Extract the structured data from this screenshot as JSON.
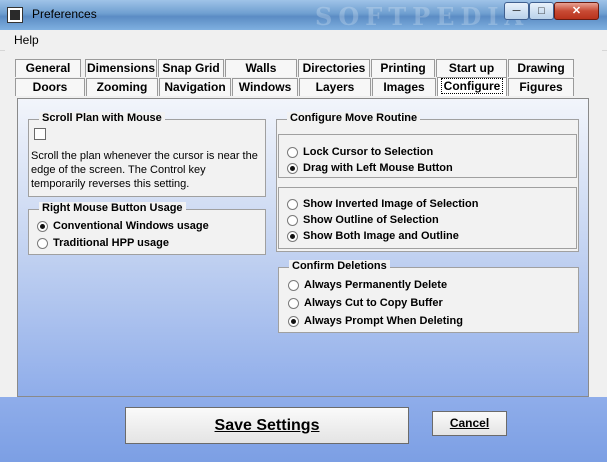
{
  "window": {
    "title": "Preferences",
    "watermark": "SOFTPEDIA"
  },
  "menu": {
    "help": "Help"
  },
  "tabs_row1": [
    "General",
    "Dimensions",
    "Snap Grid",
    "Walls",
    "Directories",
    "Printing",
    "Start up",
    "Drawing"
  ],
  "tabs_row2": [
    "Doors",
    "Zooming",
    "Navigation",
    "Windows",
    "Layers",
    "Images",
    "Configure",
    "Figures"
  ],
  "active_tab": "Configure",
  "scroll_plan": {
    "title": "Scroll Plan with Mouse",
    "checked": false,
    "description": "Scroll the plan whenever the cursor is near the edge of the screen. The Control key temporarily reverses this setting."
  },
  "right_mouse": {
    "title": "Right Mouse Button Usage",
    "options": [
      {
        "label": "Conventional Windows usage",
        "selected": true
      },
      {
        "label": "Traditional HPP usage",
        "selected": false
      }
    ]
  },
  "configure_move": {
    "title": "Configure Move Routine",
    "group1": [
      {
        "label": "Lock Cursor to Selection",
        "selected": false
      },
      {
        "label": "Drag with Left Mouse Button",
        "selected": true
      }
    ],
    "group2": [
      {
        "label": "Show Inverted Image of Selection",
        "selected": false
      },
      {
        "label": "Show Outline of Selection",
        "selected": false
      },
      {
        "label": "Show Both Image and Outline",
        "selected": true
      }
    ]
  },
  "confirm_deletions": {
    "title": "Confirm Deletions",
    "options": [
      {
        "label": "Always Permanently Delete",
        "selected": false
      },
      {
        "label": "Always Cut to Copy Buffer",
        "selected": false
      },
      {
        "label": "Always Prompt When Deleting",
        "selected": true
      }
    ]
  },
  "buttons": {
    "save": "Save Settings",
    "cancel": "Cancel"
  }
}
